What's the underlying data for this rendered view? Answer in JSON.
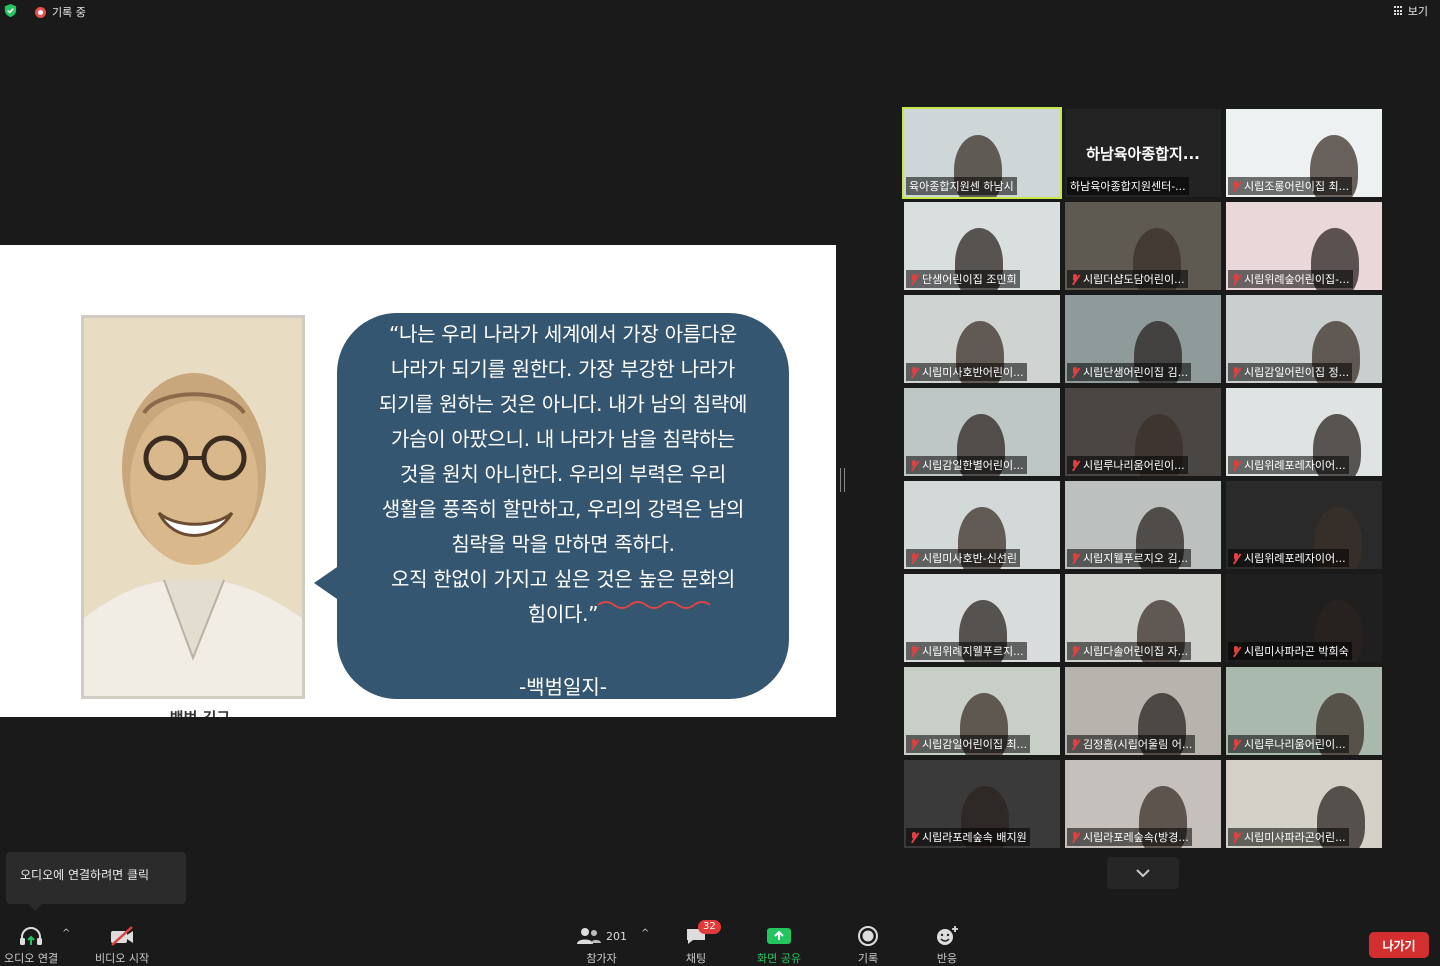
{
  "topbar": {
    "recording_label": "기록 중",
    "view_label": "보기"
  },
  "slide": {
    "quote_lines": [
      "“나는 우리 나라가 세계에서 가장 아름다운",
      "나라가 되기를 원한다. 가장 부강한 나라가",
      "되기를 원하는 것은 아니다. 내가 남의 침략에",
      "가슴이 아팠으니. 내 나라가 남을 침략하는",
      "것을 원치 아니한다. 우리의 부력은 우리",
      "생활을 풍족히 할만하고, 우리의 강력은 남의",
      "침략을 막을 만하면 족하다.",
      "오직 한없이 가지고 싶은 것은 높은 문화의",
      "힘이다.”"
    ],
    "source": "-백범일지-",
    "caption": "백범 김구"
  },
  "gallery": {
    "tiles": [
      {
        "label": "육아종합지원센 하남시",
        "muted": false,
        "active": true
      },
      {
        "label": "하남육아종합지원센터-...",
        "muted": false,
        "active": false,
        "big_name": "하남육아종합지..."
      },
      {
        "label": "시립조롱어린이집 최...",
        "muted": true,
        "active": false
      },
      {
        "label": "단샘어린이집 조민희",
        "muted": true,
        "active": false
      },
      {
        "label": "시립더샵도담어린이...",
        "muted": true,
        "active": false
      },
      {
        "label": "시립위례숲어린이집-...",
        "muted": true,
        "active": false
      },
      {
        "label": "시립미사호반어린이...",
        "muted": true,
        "active": false
      },
      {
        "label": "시립단샘어린이집 김...",
        "muted": true,
        "active": false
      },
      {
        "label": "시립감일어린이집 정...",
        "muted": true,
        "active": false
      },
      {
        "label": "시립감일한별어린이...",
        "muted": true,
        "active": false
      },
      {
        "label": "시립루나리움어린이...",
        "muted": true,
        "active": false
      },
      {
        "label": "시립위례포레자이어...",
        "muted": true,
        "active": false
      },
      {
        "label": "시립미사호반-신선린",
        "muted": true,
        "active": false
      },
      {
        "label": "시립지웰푸르지오 김...",
        "muted": true,
        "active": false
      },
      {
        "label": "시립위례포레자이어...",
        "muted": true,
        "active": false
      },
      {
        "label": "시립위례지웰푸르지...",
        "muted": true,
        "active": false
      },
      {
        "label": "시립다솔어린이집 자...",
        "muted": true,
        "active": false
      },
      {
        "label": "시립미사파라곤 박희숙",
        "muted": true,
        "active": false
      },
      {
        "label": "시립감일어린이집 최...",
        "muted": true,
        "active": false
      },
      {
        "label": "김정흠(시립어울림 어...",
        "muted": true,
        "active": false
      },
      {
        "label": "시립루나리움어린이...",
        "muted": true,
        "active": false
      },
      {
        "label": "시립라포레숲속 배지원",
        "muted": true,
        "active": false
      },
      {
        "label": "시립라포레숲속(방경...",
        "muted": true,
        "active": false
      },
      {
        "label": "시립미사파라곤어린...",
        "muted": true,
        "active": false
      }
    ]
  },
  "tooltip": {
    "text": "오디오에 연결하려면 클릭"
  },
  "toolbar": {
    "audio_label": "오디오 연결",
    "video_label": "비디오 시작",
    "participants_label": "참가자",
    "participants_count": "201",
    "chat_label": "채팅",
    "chat_badge": "32",
    "share_label": "화면 공유",
    "record_label": "기록",
    "reactions_label": "반응",
    "leave_label": "나가기"
  },
  "colors": {
    "accent_green": "#22c55e",
    "leave_red": "#d32f2f",
    "bubble_blue": "#355670",
    "active_speaker": "#c5e847"
  }
}
